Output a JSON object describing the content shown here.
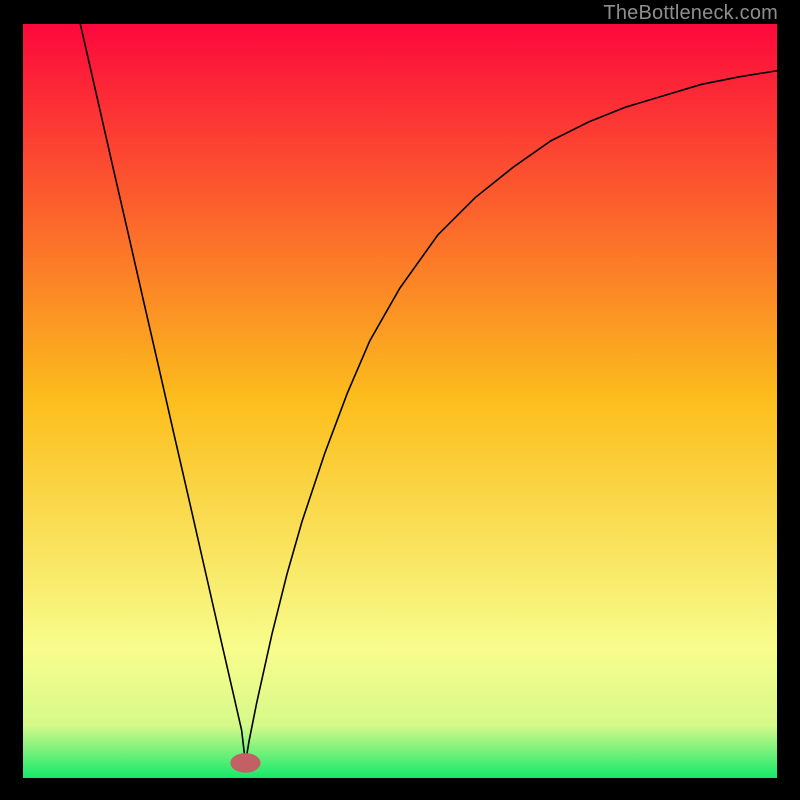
{
  "watermark": "TheBottleneck.com",
  "chart_data": {
    "type": "line",
    "title": "",
    "xlabel": "",
    "ylabel": "",
    "xlim": [
      0,
      100
    ],
    "ylim": [
      0,
      100
    ],
    "grid": false,
    "background_gradient": {
      "top": "#fc083c",
      "mid": "#fcbe1c",
      "bottom_band": "#f8fd8c",
      "bottom": "#15e96b"
    },
    "marker": {
      "x": 29.5,
      "y": 2.0,
      "rx": 2.0,
      "ry": 1.3,
      "fill": "#c26064"
    },
    "series": [
      {
        "name": "curve",
        "type": "line",
        "style": {
          "stroke": "#000000",
          "width": 1.6
        },
        "x": [
          7.6,
          10,
          12,
          14,
          16,
          18,
          20,
          22,
          24,
          26,
          28,
          29,
          29.5,
          30,
          31,
          33,
          35,
          37,
          40,
          43,
          46,
          50,
          55,
          60,
          65,
          70,
          75,
          80,
          85,
          90,
          95,
          100
        ],
        "y": [
          100,
          89.5,
          80.7,
          72,
          63.2,
          54.5,
          45.7,
          37,
          28.2,
          19.4,
          10.7,
          6.3,
          2.0,
          5,
          10,
          19,
          27,
          34,
          43,
          51,
          58,
          65,
          72,
          77,
          81,
          84.5,
          87,
          89,
          90.5,
          92,
          93,
          93.8
        ]
      }
    ]
  }
}
